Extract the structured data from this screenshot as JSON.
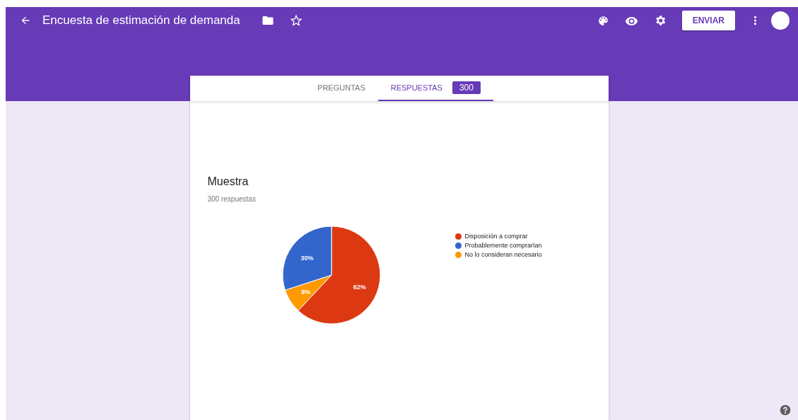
{
  "header": {
    "title": "Encuesta de estimación de demanda",
    "send_button": "ENVIAR"
  },
  "tabs": [
    {
      "label": "PREGUNTAS",
      "selected": false
    },
    {
      "label": "RESPUESTAS",
      "selected": true,
      "badge": "300"
    }
  ],
  "question": {
    "title": "Muestra",
    "count": "300 respuestas",
    "chart_data": {
      "type": "pie",
      "categories": [
        "Disposición a comprar",
        "Probablemente comprarían",
        "No lo consideran necesario"
      ],
      "series": [
        {
          "values": [
            62,
            30,
            8
          ]
        }
      ],
      "colors": [
        "#dc3912",
        "#3366cc",
        "#ff9900"
      ],
      "data_labels": "value_labels",
      "value_labels": [
        "62%",
        "30%",
        "8%"
      ],
      "legend": "right"
    }
  }
}
